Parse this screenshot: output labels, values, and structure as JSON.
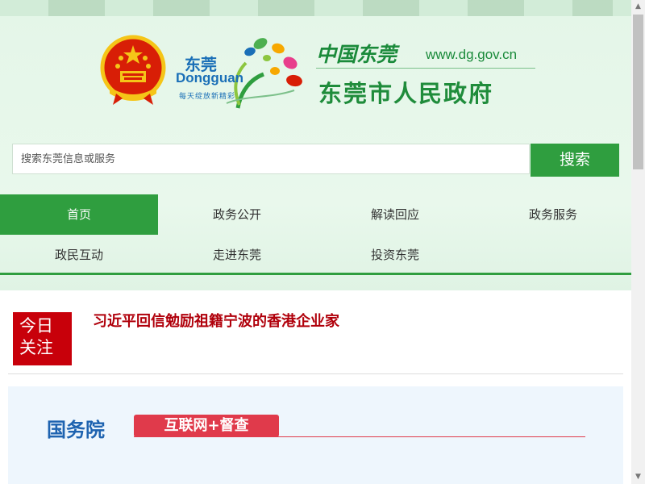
{
  "header": {
    "logo_cn": "东莞",
    "logo_en": "Dongguan",
    "logo_slogan": "每天绽放新精彩",
    "calligraphy": "中国东莞",
    "site_url": "www.dg.gov.cn",
    "gov_name": "东莞市人民政府"
  },
  "search": {
    "placeholder": "搜索东莞信息或服务",
    "button": "搜索"
  },
  "nav": {
    "items": [
      {
        "label": "首页",
        "active": true
      },
      {
        "label": "政务公开"
      },
      {
        "label": "解读回应"
      },
      {
        "label": "政务服务"
      },
      {
        "label": "政民互动"
      },
      {
        "label": "走进东莞"
      },
      {
        "label": "投资东莞"
      }
    ]
  },
  "focus": {
    "badge_line1": "今日",
    "badge_line2": "关注",
    "headline": "习近平回信勉励祖籍宁波的香港企业家"
  },
  "banner": {
    "title": "国务院",
    "tag": "互联网+督查"
  },
  "colors": {
    "brand_green": "#2f9e3f",
    "header_bg": "#e4f6e8",
    "focus_red": "#c8000a",
    "gov_blue": "#1e63b0"
  }
}
